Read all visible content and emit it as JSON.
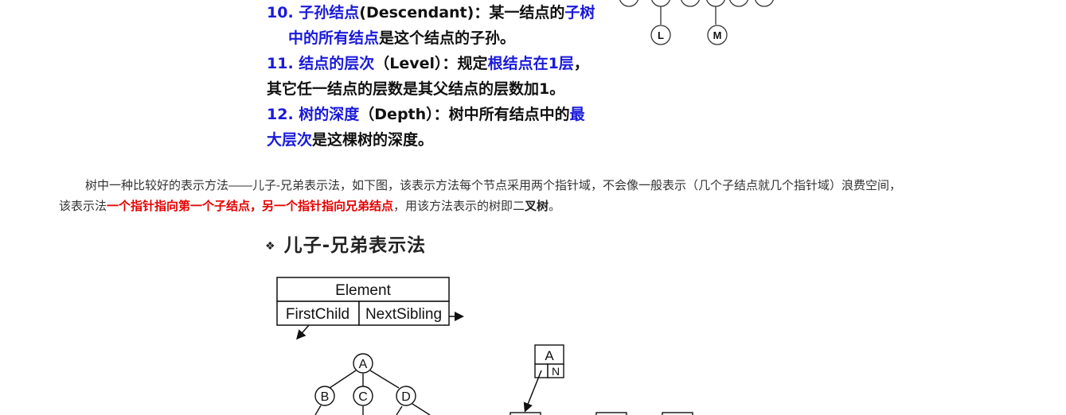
{
  "definitions": [
    {
      "segments": [
        {
          "text": "10. 子孙结点",
          "color": "blue"
        },
        {
          "text": "(Descendant)：某一结点的",
          "color": "black"
        },
        {
          "text": "子树",
          "color": "blue"
        }
      ],
      "continuation": [
        {
          "text": "中的所有结点",
          "color": "blue"
        },
        {
          "text": "是这个结点的子孙。",
          "color": "black"
        }
      ]
    },
    {
      "segments": [
        {
          "text": "11. 结点的层次",
          "color": "blue"
        },
        {
          "text": "（Level）：规定",
          "color": "black"
        },
        {
          "text": "根结点在1层",
          "color": "blue"
        },
        {
          "text": "，",
          "color": "black"
        }
      ],
      "continuation": [
        {
          "text": "其它任一结点的层数是其父结点的层数加1。",
          "color": "black"
        }
      ]
    },
    {
      "segments": [
        {
          "text": "12. 树的深度",
          "color": "blue"
        },
        {
          "text": "（Depth）：树中所有结点中的",
          "color": "black"
        },
        {
          "text": "最",
          "color": "blue"
        }
      ],
      "continuation": [
        {
          "text": "大层次",
          "color": "blue"
        },
        {
          "text": "是这棵树的深度。",
          "color": "black"
        }
      ]
    }
  ],
  "top_tree": {
    "leaf_nodes": [
      "L",
      "M"
    ]
  },
  "paragraph": {
    "line1": "树中一种比较好的表示方法——儿子-兄弟表示法，如下图，该表示方法每个节点采用两个指针域，不会像一般表示（几个子结点就几个指针域）浪费空间，",
    "line2_prefix": "该表示法",
    "line2_red": "一个指针指向第一个子结点，另一个指针指向兄弟结点",
    "line2_mid": "，用该方法表示的树即二",
    "line2_bold": "叉树",
    "line2_end": "。"
  },
  "section": {
    "bullet": "❖",
    "title": "儿子-兄弟表示法"
  },
  "node_structure": {
    "element_label": "Element",
    "first_child_label": "FirstChild",
    "next_sibling_label": "NextSibling"
  },
  "example_tree": {
    "nodes": [
      "A",
      "B",
      "C",
      "D"
    ]
  },
  "binary_node": {
    "value": "A",
    "sibling_label": "N"
  },
  "colors": {
    "blue": "#1a1adb",
    "red": "#e50000",
    "text": "#222222"
  }
}
